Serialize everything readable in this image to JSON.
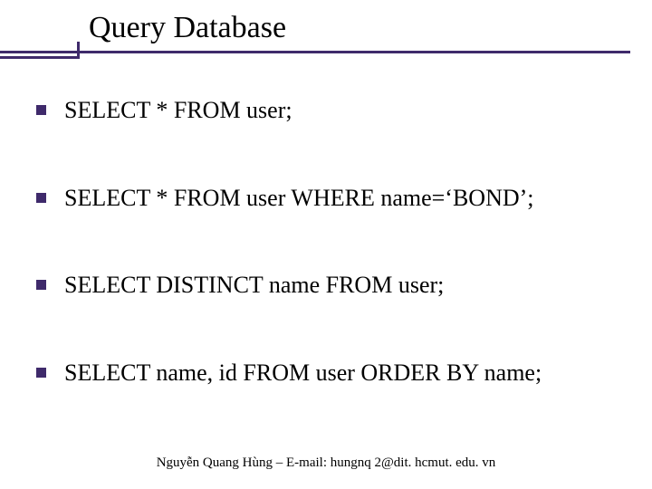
{
  "title": "Query Database",
  "items": [
    "SELECT * FROM user;",
    "SELECT * FROM user WHERE name=‘BOND’;",
    "SELECT DISTINCT name FROM user;",
    "SELECT name, id FROM user ORDER BY name;"
  ],
  "footer": "Nguyễn Quang Hùng – E-mail: hungnq 2@dit. hcmut. edu. vn"
}
